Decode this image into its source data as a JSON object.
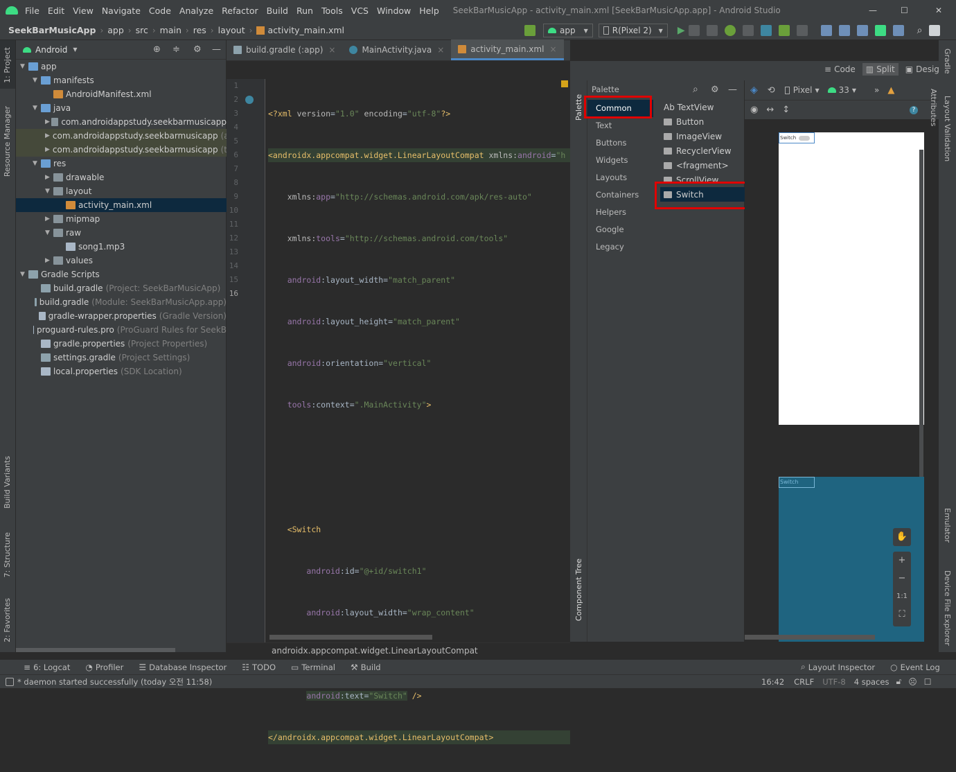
{
  "title": {
    "menus": [
      "File",
      "Edit",
      "View",
      "Navigate",
      "Code",
      "Analyze",
      "Refactor",
      "Build",
      "Run",
      "Tools",
      "VCS",
      "Window",
      "Help"
    ],
    "window_title": "SeekBarMusicApp - activity_main.xml [SeekBarMusicApp.app] - Android Studio",
    "minimize": "—",
    "maximize": "☐",
    "close": "✕"
  },
  "breadcrumb": {
    "items": [
      "SeekBarMusicApp",
      "app",
      "src",
      "main",
      "res",
      "layout",
      "activity_main.xml"
    ]
  },
  "toolbar": {
    "config": "app",
    "device": "R(Pixel 2)"
  },
  "left_strip": {
    "project": "1: Project",
    "resource_manager": "Resource Manager",
    "build_variants": "Build Variants",
    "structure": "7: Structure",
    "favorites": "2: Favorites"
  },
  "right_strip": {
    "gradle": "Gradle",
    "layout_validation": "Layout Validation",
    "emulator": "Emulator",
    "device_file_explorer": "Device File Explorer",
    "attributes": "Attributes"
  },
  "project_panel": {
    "view_mode": "Android",
    "tree": [
      {
        "label": "app",
        "depth": 0,
        "arrow": "▼",
        "icon": "folderb"
      },
      {
        "label": "manifests",
        "depth": 1,
        "arrow": "▼",
        "icon": "folderb"
      },
      {
        "label": "AndroidManifest.xml",
        "depth": 2,
        "arrow": "",
        "icon": "xmlic"
      },
      {
        "label": "java",
        "depth": 1,
        "arrow": "▼",
        "icon": "folderb"
      },
      {
        "label": "com.androidappstudy.seekbarmusicapp",
        "depth": 2,
        "arrow": "▶",
        "icon": "folder"
      },
      {
        "label": "com.androidappstudy.seekbarmusicapp",
        "suffix": "(a",
        "depth": 2,
        "arrow": "▶",
        "icon": "folder",
        "hl": true
      },
      {
        "label": "com.androidappstudy.seekbarmusicapp",
        "suffix": "(te",
        "depth": 2,
        "arrow": "▶",
        "icon": "folder",
        "hl": true
      },
      {
        "label": "res",
        "depth": 1,
        "arrow": "▼",
        "icon": "folderb"
      },
      {
        "label": "drawable",
        "depth": 2,
        "arrow": "▶",
        "icon": "folder"
      },
      {
        "label": "layout",
        "depth": 2,
        "arrow": "▼",
        "icon": "folder"
      },
      {
        "label": "activity_main.xml",
        "depth": 3,
        "arrow": "",
        "icon": "xmlic",
        "sel": true
      },
      {
        "label": "mipmap",
        "depth": 2,
        "arrow": "▶",
        "icon": "folder"
      },
      {
        "label": "raw",
        "depth": 2,
        "arrow": "▼",
        "icon": "folder"
      },
      {
        "label": "song1.mp3",
        "depth": 3,
        "arrow": "",
        "icon": "file"
      },
      {
        "label": "values",
        "depth": 2,
        "arrow": "▶",
        "icon": "folder"
      },
      {
        "label": "Gradle Scripts",
        "depth": 0,
        "arrow": "▼",
        "icon": "gradic"
      },
      {
        "label": "build.gradle",
        "suffix": "(Project: SeekBarMusicApp)",
        "depth": 1,
        "arrow": "",
        "icon": "gradic"
      },
      {
        "label": "build.gradle",
        "suffix": "(Module: SeekBarMusicApp.app)",
        "depth": 1,
        "arrow": "",
        "icon": "gradic"
      },
      {
        "label": "gradle-wrapper.properties",
        "suffix": "(Gradle Version)",
        "depth": 1,
        "arrow": "",
        "icon": "file"
      },
      {
        "label": "proguard-rules.pro",
        "suffix": "(ProGuard Rules for SeekB",
        "depth": 1,
        "arrow": "",
        "icon": "file"
      },
      {
        "label": "gradle.properties",
        "suffix": "(Project Properties)",
        "depth": 1,
        "arrow": "",
        "icon": "file"
      },
      {
        "label": "settings.gradle",
        "suffix": "(Project Settings)",
        "depth": 1,
        "arrow": "",
        "icon": "gradic"
      },
      {
        "label": "local.properties",
        "suffix": "(SDK Location)",
        "depth": 1,
        "arrow": "",
        "icon": "file"
      }
    ]
  },
  "editor": {
    "tabs": [
      {
        "label": "build.gradle (:app)",
        "active": false
      },
      {
        "label": "MainActivity.java",
        "active": false
      },
      {
        "label": "activity_main.xml",
        "active": true
      }
    ],
    "line_numbers": [
      "1",
      "2",
      "3",
      "4",
      "5",
      "6",
      "7",
      "8",
      "9",
      "10",
      "11",
      "12",
      "13",
      "14",
      "15",
      "16"
    ],
    "footer": "androidx.appcompat.widget.LinearLayoutCompat"
  },
  "view_modes": {
    "code": "Code",
    "split": "Split",
    "design": "Design"
  },
  "palette": {
    "title": "Palette",
    "strip_label": "Palette",
    "component_tree": "Component Tree",
    "categories": [
      "Common",
      "Text",
      "Buttons",
      "Widgets",
      "Layouts",
      "Containers",
      "Helpers",
      "Google",
      "Legacy"
    ],
    "selected_category": "Common",
    "widgets": [
      "Ab TextView",
      "Button",
      "ImageView",
      "RecyclerView",
      "<fragment>",
      "ScrollView",
      "Switch"
    ],
    "selected_widget": "Switch"
  },
  "design_toolbar": {
    "device": "Pixel",
    "api": "33"
  },
  "preview": {
    "switch_label": "Switch",
    "zoom_fit": "1:1"
  },
  "bottom_tabs": {
    "logcat": "6: Logcat",
    "profiler": "Profiler",
    "database": "Database Inspector",
    "todo": "TODO",
    "terminal": "Terminal",
    "build": "Build",
    "layout_inspector": "Layout Inspector",
    "event_log": "Event Log"
  },
  "status": {
    "message": "* daemon started successfully (today 오전 11:58)",
    "position": "16:42",
    "line_sep": "CRLF",
    "encoding": "UTF-8",
    "indent": "4 spaces"
  },
  "colors": {
    "accent": "#4a88c7",
    "highlight_box": "#e00000",
    "selection": "#0d293e"
  }
}
